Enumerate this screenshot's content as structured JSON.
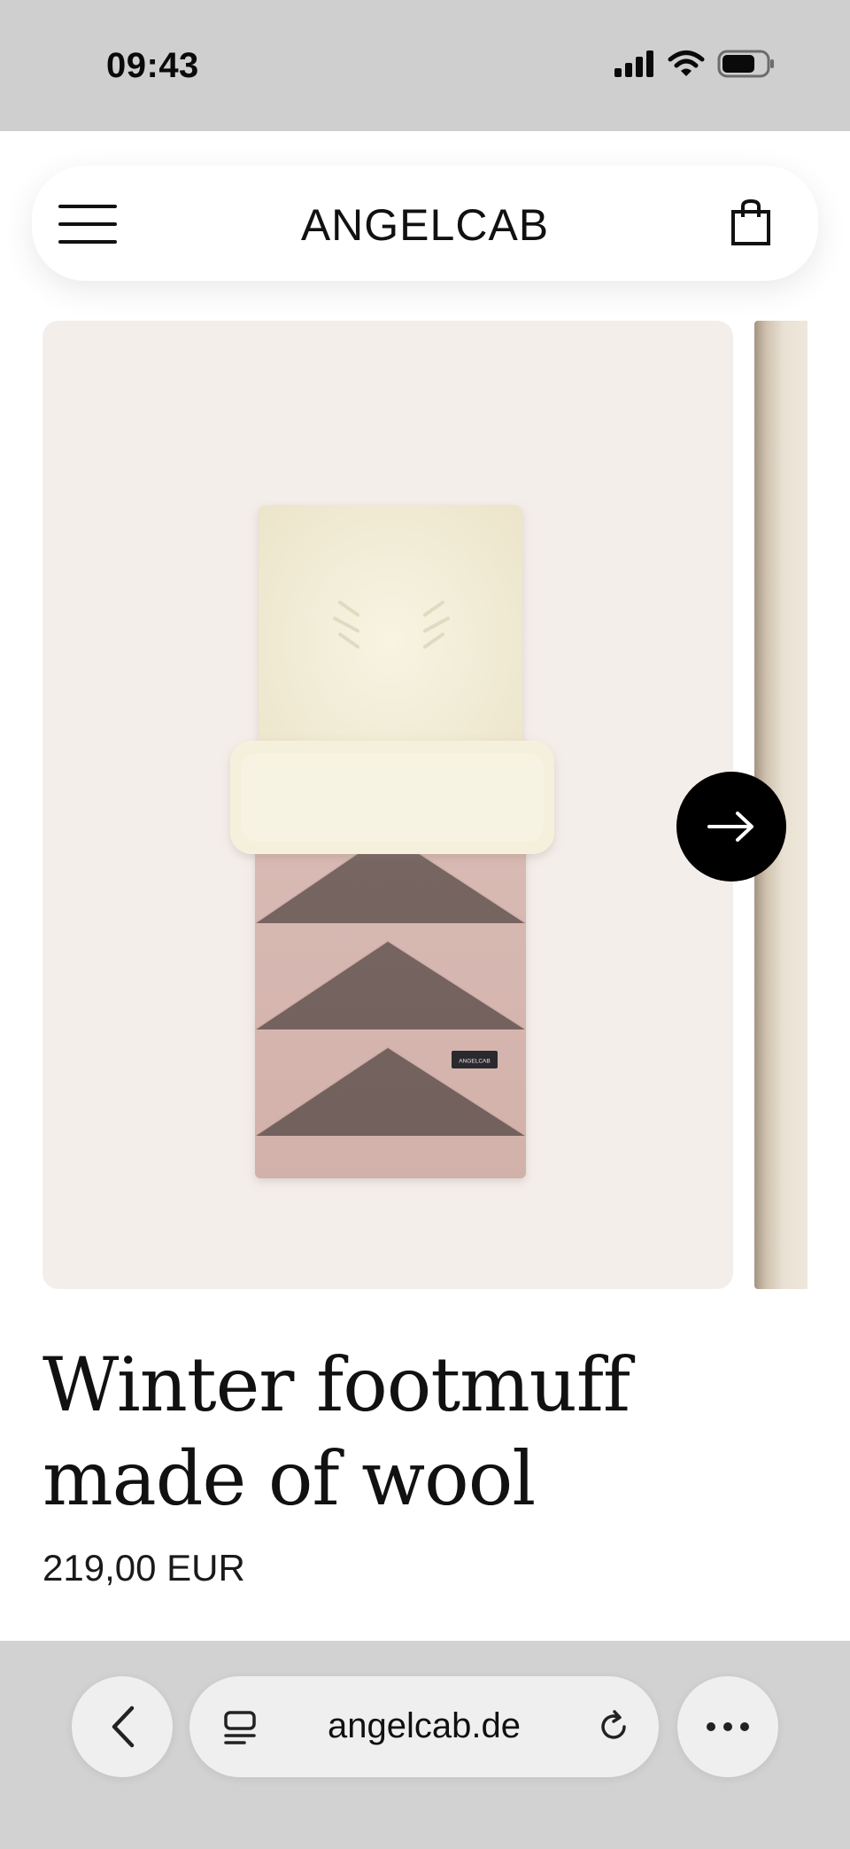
{
  "status_bar": {
    "time": "09:43"
  },
  "header": {
    "brand": "ANGELCAB"
  },
  "product_image": {
    "tag_text": "ANGELCAB"
  },
  "product": {
    "title": "Winter footmuff made of wool",
    "price": "219,00 EUR"
  },
  "browser": {
    "url": "angelcab.de"
  },
  "colors": {
    "accent_black": "#000000",
    "image_background": "#f4eeeb",
    "sheepskin_cream": "#f4efd9",
    "footmuff_pink": "#d6b6b0",
    "status_bar_bg": "#cfcfcf",
    "browser_bar_bg": "#d2d2d2"
  },
  "icons": [
    "signal-icon",
    "wifi-icon",
    "battery-icon",
    "hamburger-menu-icon",
    "shopping-bag-icon",
    "arrow-right-icon",
    "chevron-left-icon",
    "reader-mode-icon",
    "reload-icon",
    "more-icon"
  ]
}
